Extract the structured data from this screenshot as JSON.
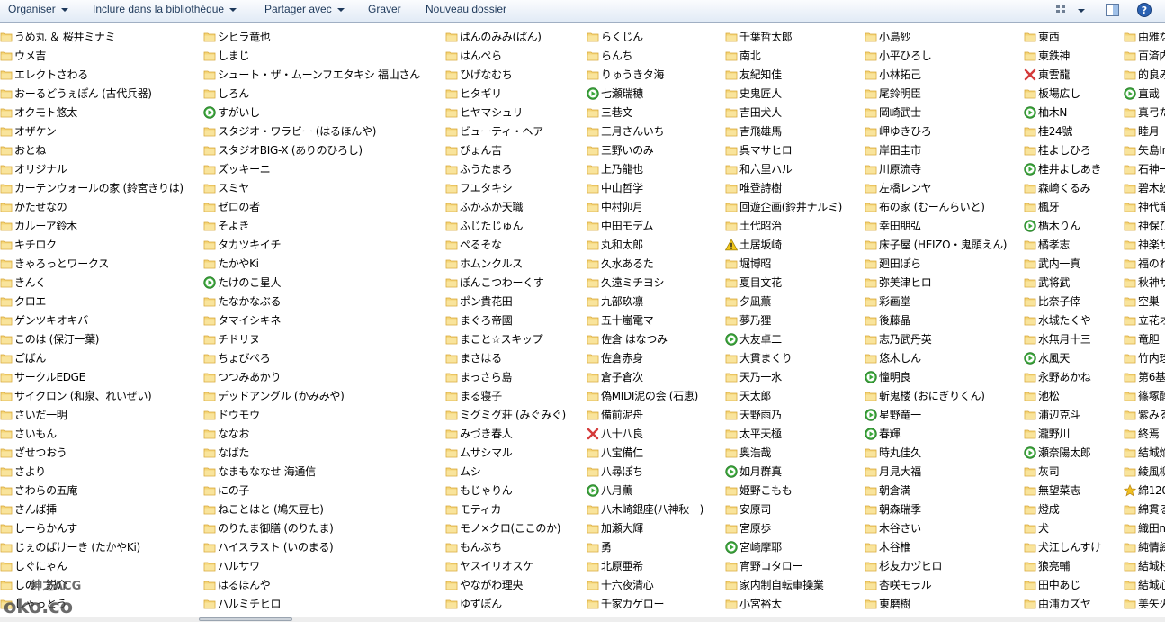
{
  "toolbar": {
    "organize": "Organiser",
    "include_library": "Inclure dans la bibliothèque",
    "share_with": "Partager avec",
    "burn": "Graver",
    "new_folder": "Nouveau dossier"
  },
  "colors": {
    "folder": "#f5d679",
    "folder_dark": "#d8a83a",
    "green_play": "#3aa63a",
    "red_x": "#d43a3a",
    "warning": "#f2c81b",
    "star": "#f0c020"
  },
  "columns": [
    {
      "items": [
        {
          "name": "うめ丸 ＆ 桜井ミナミ",
          "icon": "folder"
        },
        {
          "name": "ウメ吉",
          "icon": "folder"
        },
        {
          "name": "エレクトさわる",
          "icon": "folder"
        },
        {
          "name": "おーるどうぇぽん (古代兵器)",
          "icon": "folder"
        },
        {
          "name": "オクモト悠太",
          "icon": "folder"
        },
        {
          "name": "オザケン",
          "icon": "folder"
        },
        {
          "name": "おとね",
          "icon": "folder"
        },
        {
          "name": "オリジナル",
          "icon": "folder"
        },
        {
          "name": "カーテンウォールの家 (鈴宮きりは)",
          "icon": "folder"
        },
        {
          "name": "かたせなの",
          "icon": "folder"
        },
        {
          "name": "カルーア鈴木",
          "icon": "folder"
        },
        {
          "name": "キチロク",
          "icon": "folder"
        },
        {
          "name": "きゃろっとワークス",
          "icon": "folder"
        },
        {
          "name": "きんく",
          "icon": "folder"
        },
        {
          "name": "クロエ",
          "icon": "folder"
        },
        {
          "name": "ゲンツキオキバ",
          "icon": "folder"
        },
        {
          "name": "このは (保汀一葉)",
          "icon": "folder"
        },
        {
          "name": "ごばん",
          "icon": "folder"
        },
        {
          "name": "サークルEDGE",
          "icon": "folder"
        },
        {
          "name": "サイクロン (和泉、れいぜい)",
          "icon": "folder"
        },
        {
          "name": "さいだ一明",
          "icon": "folder"
        },
        {
          "name": "さいもん",
          "icon": "folder"
        },
        {
          "name": "ざせつおう",
          "icon": "folder"
        },
        {
          "name": "さより",
          "icon": "folder"
        },
        {
          "name": "さわらの五庵",
          "icon": "folder"
        },
        {
          "name": "さんば挿",
          "icon": "folder"
        },
        {
          "name": "しーらかんす",
          "icon": "folder"
        },
        {
          "name": "じぇのばけーき (たかやKi)",
          "icon": "folder"
        },
        {
          "name": "しぐにゃん",
          "icon": "folder"
        },
        {
          "name": "しの　鋭介",
          "icon": "folder"
        },
        {
          "name": "しゃっとう",
          "icon": "folder"
        }
      ]
    },
    {
      "items": [
        {
          "name": "シヒラ竜也",
          "icon": "folder"
        },
        {
          "name": "しまじ",
          "icon": "folder"
        },
        {
          "name": "シュート・ザ・ムーンフエタキシ 福山さん",
          "icon": "folder"
        },
        {
          "name": "しろん",
          "icon": "folder"
        },
        {
          "name": "すがいし",
          "icon": "green"
        },
        {
          "name": "スタジオ・ワラビー (はるほんや)",
          "icon": "folder"
        },
        {
          "name": "スタジオBIG-X (ありのひろし)",
          "icon": "folder"
        },
        {
          "name": "ズッキーニ",
          "icon": "folder"
        },
        {
          "name": "スミヤ",
          "icon": "folder"
        },
        {
          "name": "ゼロの者",
          "icon": "folder"
        },
        {
          "name": "そよき",
          "icon": "folder"
        },
        {
          "name": "タカツキイチ",
          "icon": "folder"
        },
        {
          "name": "たかやKi",
          "icon": "folder"
        },
        {
          "name": "たけのこ星人",
          "icon": "green"
        },
        {
          "name": "たなかなぶる",
          "icon": "folder"
        },
        {
          "name": "タマイシキネ",
          "icon": "folder"
        },
        {
          "name": "チドリヌ",
          "icon": "folder"
        },
        {
          "name": "ちょびぺろ",
          "icon": "folder"
        },
        {
          "name": "つつみあかり",
          "icon": "folder"
        },
        {
          "name": "デッドアングル (かみみや)",
          "icon": "folder"
        },
        {
          "name": "ドウモウ",
          "icon": "folder"
        },
        {
          "name": "ななお",
          "icon": "folder"
        },
        {
          "name": "なばた",
          "icon": "folder"
        },
        {
          "name": "なまもななせ 海通信",
          "icon": "folder"
        },
        {
          "name": "にの子",
          "icon": "folder"
        },
        {
          "name": "ねことはと (鳩矢豆七)",
          "icon": "folder"
        },
        {
          "name": "のりたま御膳 (のりたま)",
          "icon": "folder"
        },
        {
          "name": "ハイスラスト (いのまる)",
          "icon": "folder"
        },
        {
          "name": "ハルサワ",
          "icon": "folder"
        },
        {
          "name": "はるほんや",
          "icon": "folder"
        },
        {
          "name": "ハルミチヒロ",
          "icon": "folder"
        }
      ]
    },
    {
      "items": [
        {
          "name": "ぱんのみみ(ぱん)",
          "icon": "folder"
        },
        {
          "name": "はんぺら",
          "icon": "folder"
        },
        {
          "name": "ひげなむち",
          "icon": "folder"
        },
        {
          "name": "ヒタギリ",
          "icon": "folder"
        },
        {
          "name": "ヒヤマシュリ",
          "icon": "folder"
        },
        {
          "name": "ビューティ・ヘア",
          "icon": "folder"
        },
        {
          "name": "ぴょん吉",
          "icon": "folder"
        },
        {
          "name": "ふうたまろ",
          "icon": "folder"
        },
        {
          "name": "フエタキシ",
          "icon": "folder"
        },
        {
          "name": "ふかふか天職",
          "icon": "folder"
        },
        {
          "name": "ふじたじゅん",
          "icon": "folder"
        },
        {
          "name": "ぺるそな",
          "icon": "folder"
        },
        {
          "name": "ホムンクルス",
          "icon": "folder"
        },
        {
          "name": "ぽんこつわーくす",
          "icon": "folder"
        },
        {
          "name": "ポン貴花田",
          "icon": "folder"
        },
        {
          "name": "まぐろ帝國",
          "icon": "folder"
        },
        {
          "name": "まこと☆スキップ",
          "icon": "folder"
        },
        {
          "name": "まさはる",
          "icon": "folder"
        },
        {
          "name": "まっさら島",
          "icon": "folder"
        },
        {
          "name": "まる寝子",
          "icon": "folder"
        },
        {
          "name": "ミグミグ荘 (みぐみぐ)",
          "icon": "folder"
        },
        {
          "name": "みづき春人",
          "icon": "folder"
        },
        {
          "name": "ムサシマル",
          "icon": "folder"
        },
        {
          "name": "ムシ",
          "icon": "folder"
        },
        {
          "name": "もじゃりん",
          "icon": "folder"
        },
        {
          "name": "モティカ",
          "icon": "folder"
        },
        {
          "name": "モノ×クロ(ここのか)",
          "icon": "folder"
        },
        {
          "name": "もんぷち",
          "icon": "folder"
        },
        {
          "name": "ヤスイリオスケ",
          "icon": "folder"
        },
        {
          "name": "やながわ理央",
          "icon": "folder"
        },
        {
          "name": "ゆずぽん",
          "icon": "folder"
        }
      ]
    },
    {
      "items": [
        {
          "name": "らくじん",
          "icon": "folder"
        },
        {
          "name": "らんち",
          "icon": "folder"
        },
        {
          "name": "りゅうきタ海",
          "icon": "folder"
        },
        {
          "name": "七瀬瑞穂",
          "icon": "green"
        },
        {
          "name": "三巷文",
          "icon": "folder"
        },
        {
          "name": "三月さんいち",
          "icon": "folder"
        },
        {
          "name": "三野いのみ",
          "icon": "folder"
        },
        {
          "name": "上乃龍也",
          "icon": "folder"
        },
        {
          "name": "中山哲学",
          "icon": "folder"
        },
        {
          "name": "中村卯月",
          "icon": "folder"
        },
        {
          "name": "中田モデム",
          "icon": "folder"
        },
        {
          "name": "丸和太郎",
          "icon": "folder"
        },
        {
          "name": "久水あるた",
          "icon": "folder"
        },
        {
          "name": "久遠ミチヨシ",
          "icon": "folder"
        },
        {
          "name": "九部玖凛",
          "icon": "folder"
        },
        {
          "name": "五十嵐電マ",
          "icon": "folder"
        },
        {
          "name": "佐倉 はなつみ",
          "icon": "folder"
        },
        {
          "name": "佐倉赤身",
          "icon": "folder"
        },
        {
          "name": "倉子倉次",
          "icon": "folder"
        },
        {
          "name": "偽MIDI泥の会 (石恵)",
          "icon": "folder"
        },
        {
          "name": "備前泥舟",
          "icon": "folder"
        },
        {
          "name": "八十八良",
          "icon": "red"
        },
        {
          "name": "八宝備仁",
          "icon": "folder"
        },
        {
          "name": "八尋ぽち",
          "icon": "folder"
        },
        {
          "name": "八月薫",
          "icon": "green"
        },
        {
          "name": "八木崎銀座(八神秋一)",
          "icon": "folder"
        },
        {
          "name": "加瀬大輝",
          "icon": "folder"
        },
        {
          "name": "勇",
          "icon": "folder"
        },
        {
          "name": "北原亜希",
          "icon": "folder"
        },
        {
          "name": "十六夜清心",
          "icon": "folder"
        },
        {
          "name": "千家カゲロー",
          "icon": "folder"
        }
      ]
    },
    {
      "items": [
        {
          "name": "千葉哲太郎",
          "icon": "folder"
        },
        {
          "name": "南北",
          "icon": "folder"
        },
        {
          "name": "友紀知佳",
          "icon": "folder"
        },
        {
          "name": "史鬼匠人",
          "icon": "folder"
        },
        {
          "name": "吉田犬人",
          "icon": "folder"
        },
        {
          "name": "吉飛雄馬",
          "icon": "folder"
        },
        {
          "name": "呉マサヒロ",
          "icon": "folder"
        },
        {
          "name": "和六里ハル",
          "icon": "folder"
        },
        {
          "name": "唯登詩樹",
          "icon": "folder"
        },
        {
          "name": "回遊企画(鈴井ナルミ)",
          "icon": "folder"
        },
        {
          "name": "土代昭治",
          "icon": "folder"
        },
        {
          "name": "土居坂崎",
          "icon": "warning"
        },
        {
          "name": "堀博昭",
          "icon": "folder"
        },
        {
          "name": "夏目文花",
          "icon": "folder"
        },
        {
          "name": "夕凪薫",
          "icon": "folder"
        },
        {
          "name": "夢乃狸",
          "icon": "folder"
        },
        {
          "name": "大友卓二",
          "icon": "green"
        },
        {
          "name": "大貫まくり",
          "icon": "folder"
        },
        {
          "name": "天乃一水",
          "icon": "folder"
        },
        {
          "name": "天太郎",
          "icon": "folder"
        },
        {
          "name": "天野雨乃",
          "icon": "folder"
        },
        {
          "name": "太平天極",
          "icon": "folder"
        },
        {
          "name": "奥浩哉",
          "icon": "folder"
        },
        {
          "name": "如月群真",
          "icon": "green"
        },
        {
          "name": "姫野こもも",
          "icon": "folder"
        },
        {
          "name": "安原司",
          "icon": "folder"
        },
        {
          "name": "宮原歩",
          "icon": "folder"
        },
        {
          "name": "宮崎摩耶",
          "icon": "green"
        },
        {
          "name": "宵野コタロー",
          "icon": "folder"
        },
        {
          "name": "家内制自転車操業",
          "icon": "folder"
        },
        {
          "name": "小宮裕太",
          "icon": "folder"
        }
      ]
    },
    {
      "items": [
        {
          "name": "小島紗",
          "icon": "folder"
        },
        {
          "name": "小平ひろし",
          "icon": "folder"
        },
        {
          "name": "小林拓己",
          "icon": "folder"
        },
        {
          "name": "尾鈴明臣",
          "icon": "folder"
        },
        {
          "name": "岡崎武士",
          "icon": "folder"
        },
        {
          "name": "岬ゆきひろ",
          "icon": "folder"
        },
        {
          "name": "岸田圭市",
          "icon": "folder"
        },
        {
          "name": "川原流寺",
          "icon": "folder"
        },
        {
          "name": "左橋レンヤ",
          "icon": "folder"
        },
        {
          "name": "布の家 (むーんらいと)",
          "icon": "folder"
        },
        {
          "name": "幸田朋弘",
          "icon": "folder"
        },
        {
          "name": "床子屋 (HEIZO・鬼頭えん)",
          "icon": "folder"
        },
        {
          "name": "廻田ぽら",
          "icon": "folder"
        },
        {
          "name": "弥美津ヒロ",
          "icon": "folder"
        },
        {
          "name": "彩画堂",
          "icon": "folder"
        },
        {
          "name": "後藤晶",
          "icon": "folder"
        },
        {
          "name": "志乃武丹英",
          "icon": "folder"
        },
        {
          "name": "悠木しん",
          "icon": "folder"
        },
        {
          "name": "憧明良",
          "icon": "green"
        },
        {
          "name": "斬鬼楼 (おにぎりくん)",
          "icon": "folder"
        },
        {
          "name": "星野竜一",
          "icon": "green"
        },
        {
          "name": "春輝",
          "icon": "green"
        },
        {
          "name": "時丸佳久",
          "icon": "folder"
        },
        {
          "name": "月見大福",
          "icon": "folder"
        },
        {
          "name": "朝倉満",
          "icon": "folder"
        },
        {
          "name": "朝森瑞季",
          "icon": "folder"
        },
        {
          "name": "木谷さい",
          "icon": "folder"
        },
        {
          "name": "木谷椎",
          "icon": "folder"
        },
        {
          "name": "杉友カヅヒロ",
          "icon": "folder"
        },
        {
          "name": "杏咲モラル",
          "icon": "folder"
        },
        {
          "name": "東磨樹",
          "icon": "folder"
        }
      ]
    },
    {
      "items": [
        {
          "name": "東西",
          "icon": "folder"
        },
        {
          "name": "東鉄神",
          "icon": "folder"
        },
        {
          "name": "東雲龍",
          "icon": "red"
        },
        {
          "name": "板場広し",
          "icon": "folder"
        },
        {
          "name": "柚木N",
          "icon": "green"
        },
        {
          "name": "桂24號",
          "icon": "folder"
        },
        {
          "name": "桂よしひろ",
          "icon": "folder"
        },
        {
          "name": "桂井よしあき",
          "icon": "green"
        },
        {
          "name": "森崎くるみ",
          "icon": "folder"
        },
        {
          "name": "楓牙",
          "icon": "folder"
        },
        {
          "name": "楯木りん",
          "icon": "green"
        },
        {
          "name": "橘孝志",
          "icon": "folder"
        },
        {
          "name": "武内一真",
          "icon": "folder"
        },
        {
          "name": "武将武",
          "icon": "folder"
        },
        {
          "name": "比奈子倖",
          "icon": "folder"
        },
        {
          "name": "水城たくや",
          "icon": "folder"
        },
        {
          "name": "水無月十三",
          "icon": "folder"
        },
        {
          "name": "水風天",
          "icon": "green"
        },
        {
          "name": "永野あかね",
          "icon": "folder"
        },
        {
          "name": "池松",
          "icon": "folder"
        },
        {
          "name": "浦辺克斗",
          "icon": "folder"
        },
        {
          "name": "瀧野川",
          "icon": "folder"
        },
        {
          "name": "瀬奈陽太郎",
          "icon": "green"
        },
        {
          "name": "灰司",
          "icon": "folder"
        },
        {
          "name": "無望菜志",
          "icon": "folder"
        },
        {
          "name": "燈成",
          "icon": "folder"
        },
        {
          "name": "犬",
          "icon": "folder"
        },
        {
          "name": "犬江しんすけ",
          "icon": "folder"
        },
        {
          "name": "狼亮輔",
          "icon": "folder"
        },
        {
          "name": "田中あじ",
          "icon": "folder"
        },
        {
          "name": "由浦カズヤ",
          "icon": "folder"
        }
      ]
    },
    {
      "items": [
        {
          "name": "由雅な",
          "icon": "folder"
        },
        {
          "name": "百済内",
          "icon": "folder"
        },
        {
          "name": "的良み",
          "icon": "folder"
        },
        {
          "name": "直哉",
          "icon": "green"
        },
        {
          "name": "真弓た",
          "icon": "folder"
        },
        {
          "name": "睦月",
          "icon": "folder"
        },
        {
          "name": "矢島In",
          "icon": "folder"
        },
        {
          "name": "石神一",
          "icon": "folder"
        },
        {
          "name": "碧木紗",
          "icon": "folder"
        },
        {
          "name": "神代竜",
          "icon": "folder"
        },
        {
          "name": "神保ひ",
          "icon": "folder"
        },
        {
          "name": "神楽サ",
          "icon": "folder"
        },
        {
          "name": "福のれ",
          "icon": "folder"
        },
        {
          "name": "秋神サ",
          "icon": "folder"
        },
        {
          "name": "空巣",
          "icon": "folder"
        },
        {
          "name": "立花オ",
          "icon": "folder"
        },
        {
          "name": "竜胆",
          "icon": "folder"
        },
        {
          "name": "竹内珪",
          "icon": "folder"
        },
        {
          "name": "第6基",
          "icon": "folder"
        },
        {
          "name": "篠塚醇",
          "icon": "folder"
        },
        {
          "name": "紫みる",
          "icon": "folder"
        },
        {
          "name": "終焉",
          "icon": "folder"
        },
        {
          "name": "結城焔",
          "icon": "folder"
        },
        {
          "name": "綾風柳",
          "icon": "folder"
        },
        {
          "name": "綿120",
          "icon": "star"
        },
        {
          "name": "綿貫る",
          "icon": "folder"
        },
        {
          "name": "織田n",
          "icon": "folder"
        },
        {
          "name": "純情練",
          "icon": "folder"
        },
        {
          "name": "結城杉",
          "icon": "folder"
        },
        {
          "name": "結城心",
          "icon": "folder"
        },
        {
          "name": "美矢火",
          "icon": "folder"
        }
      ]
    }
  ],
  "watermark": {
    "line1": "绅之ACG",
    "line2": "oko.co"
  }
}
